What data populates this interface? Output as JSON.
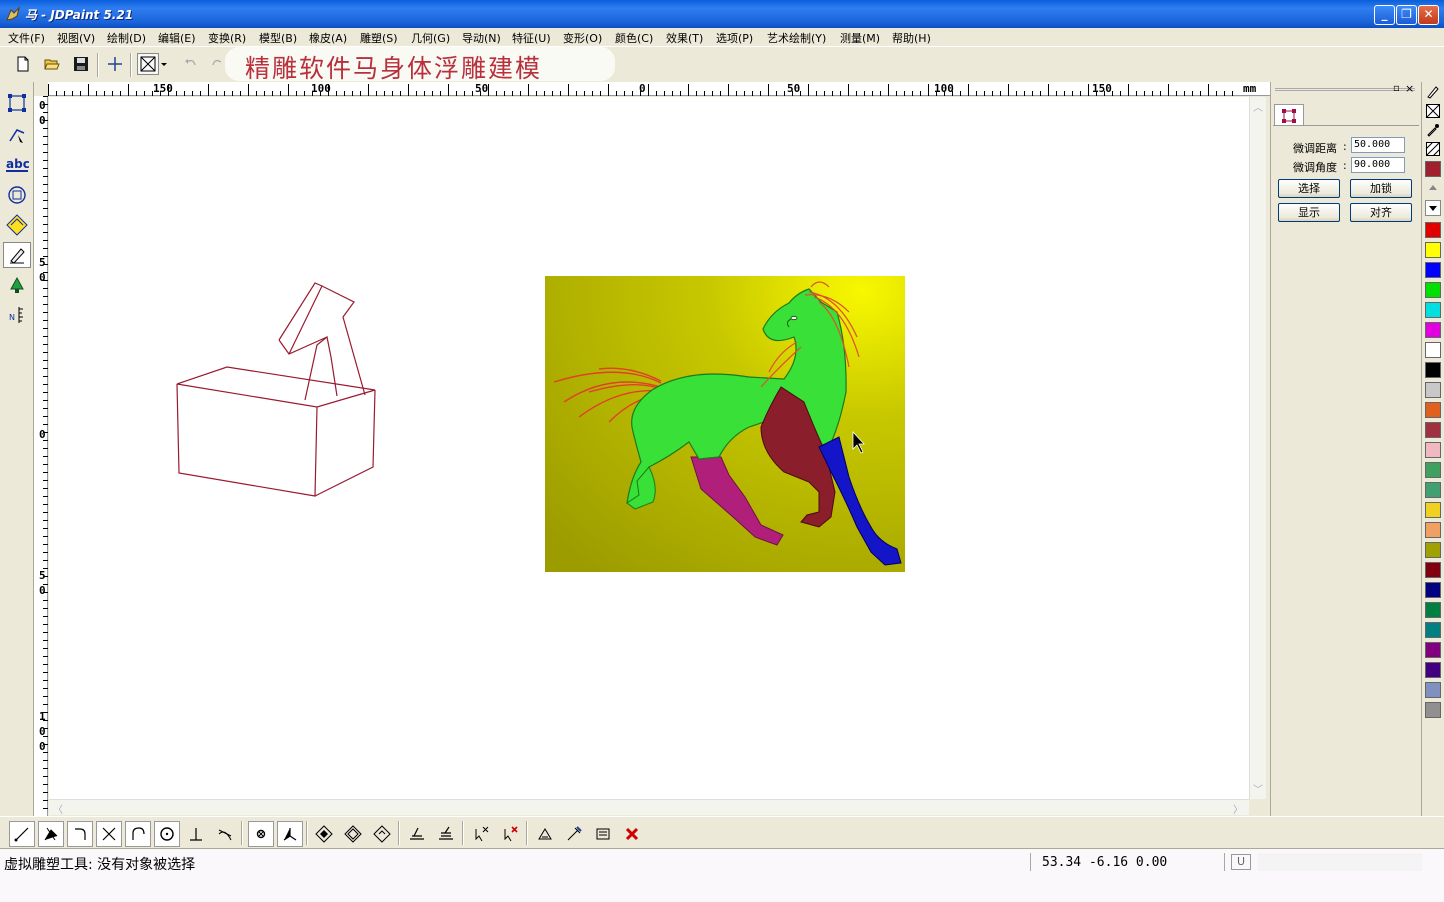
{
  "window": {
    "title": "马 - JDPaint 5.21"
  },
  "menu": [
    "文件(F)",
    "视图(V)",
    "绘制(D)",
    "编辑(E)",
    "变换(R)",
    "模型(B)",
    "橡皮(A)",
    "雕塑(S)",
    "几何(G)",
    "导动(N)",
    "特征(U)",
    "变形(O)",
    "颜色(C)",
    "效果(T)",
    "选项(P)",
    "艺术绘制(Y)",
    "测量(M)",
    "帮助(H)"
  ],
  "watermark": "精雕软件马身体浮雕建模",
  "ruler": {
    "unit": "mm",
    "top_labels": [
      "150",
      "100",
      "50",
      "0",
      "50",
      "100",
      "150"
    ],
    "left_labels": [
      [
        "0",
        "0"
      ],
      [
        "5",
        "0"
      ],
      [
        "0"
      ],
      [
        "5",
        "0"
      ],
      [
        "1",
        "0",
        "0"
      ]
    ]
  },
  "panel": {
    "fine_distance_label": "微调距离",
    "fine_distance_value": "50.000",
    "fine_angle_label": "微调角度",
    "fine_angle_value": "90.000",
    "select_button": "选择",
    "lock_button": "加锁",
    "show_button": "显示",
    "align_button": "对齐"
  },
  "palette": {
    "colors": [
      "#e00000",
      "#ffff00",
      "#0000ff",
      "#00e000",
      "#00e0e0",
      "#e000e0",
      "#ffffff",
      "#000000",
      "#c8c8c8",
      "#e06020",
      "#a03040",
      "#f0b8c0",
      "#40a060",
      "#40a070",
      "#f0d020",
      "#f0a060",
      "#a0a000",
      "#800010",
      "#000080",
      "#008040",
      "#008080",
      "#800080",
      "#400080",
      "#8090c0",
      "#909090"
    ]
  },
  "status": {
    "message": "虚拟雕塑工具: 没有对象被选择",
    "coords": "53.34 -6.16 0.00",
    "mode": "U"
  },
  "icons": {
    "left_toolbar": [
      "select-box-icon",
      "node-edit-icon",
      "text-abc-icon",
      "circle-tool-icon",
      "sculpt-icon",
      "pen-icon",
      "fill-icon",
      "measure-icon"
    ],
    "bottom_toolbar": [
      "line-icon",
      "polyline-icon",
      "arc-icon",
      "cross-icon",
      "curve-icon",
      "circle-icon",
      "perpendicular-icon",
      "tangent-icon",
      "point-icon",
      "angle-icon",
      "diamond-icon-1",
      "diamond-icon-2",
      "diamond-icon-3",
      "level-icon-1",
      "level-icon-2",
      "pick-icon-1",
      "pick-icon-2",
      "transform-icon-1",
      "transform-icon-2",
      "transform-icon-3",
      "delete-icon"
    ]
  }
}
